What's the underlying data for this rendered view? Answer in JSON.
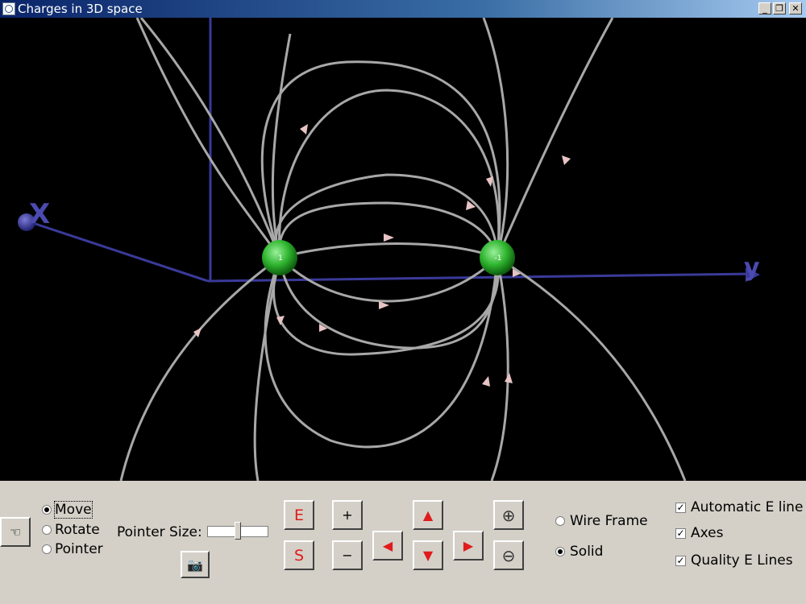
{
  "window": {
    "title": "Charges in 3D space",
    "minimize": "_",
    "restore": "❐",
    "close": "✕"
  },
  "scene": {
    "axes": {
      "x_label": "X",
      "y_label": "y"
    },
    "charges": [
      {
        "label": "1",
        "color": "#2fb52f"
      },
      {
        "label": "-1",
        "color": "#2fb52f"
      }
    ],
    "axis_color": "#3a3a9a",
    "field_line_color": "#a8a8a8",
    "arrow_color": "#e8c4c4"
  },
  "controls": {
    "mode_options": [
      {
        "label": "Move",
        "selected": true
      },
      {
        "label": "Rotate",
        "selected": false
      },
      {
        "label": "Pointer",
        "selected": false
      }
    ],
    "pointer_size_label": "Pointer Size:",
    "pointer_size_level": 0.5,
    "e_button": "E",
    "s_button": "S",
    "plus_button": "+",
    "minus_button": "−",
    "hand_icon": "☜",
    "camera_icon": "📷",
    "up_arrow": "➡",
    "zoom_in": "⊕",
    "zoom_out": "⊖",
    "render_options": [
      {
        "label": "Wire Frame",
        "selected": false
      },
      {
        "label": "Solid",
        "selected": true
      }
    ],
    "checkboxes": [
      {
        "label": "Automatic E line",
        "checked": true
      },
      {
        "label": "Axes",
        "checked": true
      },
      {
        "label": "Quality E Lines",
        "checked": true
      }
    ],
    "check_mark": "✓"
  }
}
